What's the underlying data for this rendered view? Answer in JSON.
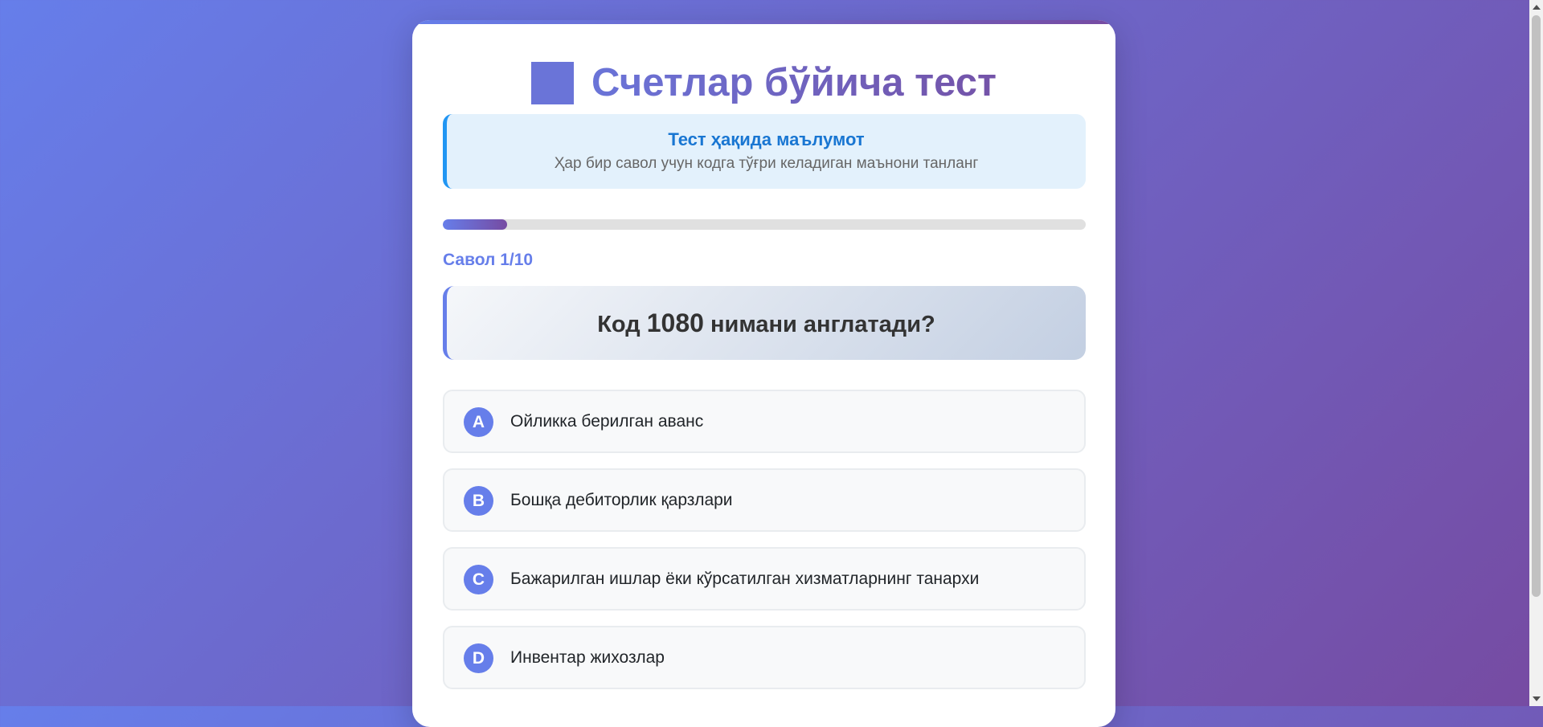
{
  "title": {
    "icon": "blue-square-icon",
    "text": "Счетлар бўйича тест"
  },
  "info": {
    "title": "Тест ҳақида маълумот",
    "text": "Ҳар бир савол учун кодга тўғри келадиган маънони танланг"
  },
  "progress": {
    "fraction": 0.1
  },
  "question": {
    "counter": "Савол 1/10",
    "prefix": "Код",
    "code": "1080",
    "suffix": "нимани англатади?"
  },
  "options": [
    {
      "letter": "A",
      "text": "Ойликка берилган аванс"
    },
    {
      "letter": "B",
      "text": "Бошқа дебиторлик қарзлари"
    },
    {
      "letter": "C",
      "text": "Бажарилган ишлар ёки кўрсатилган хизматларнинг танархи"
    },
    {
      "letter": "D",
      "text": "Инвентар жихозлар"
    }
  ],
  "colors": {
    "background_start": "#667eea",
    "background_end": "#764ba2",
    "accent": "#667eea",
    "info_accent": "#2196f3"
  }
}
